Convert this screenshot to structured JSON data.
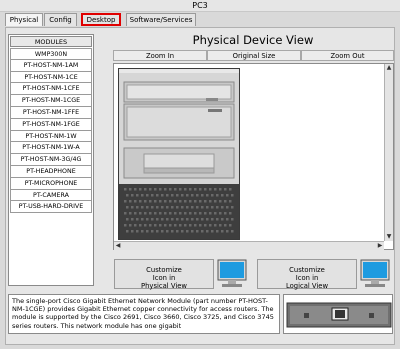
{
  "window": {
    "title": "PC3"
  },
  "tabs": [
    {
      "label": "Physical"
    },
    {
      "label": "Config"
    },
    {
      "label": "Desktop"
    },
    {
      "label": "Software/Services"
    }
  ],
  "modules": {
    "header": "MODULES",
    "items": [
      "WMP300N",
      "PT-HOST-NM-1AM",
      "PT-HOST-NM-1CE",
      "PT-HOST-NM-1CFE",
      "PT-HOST-NM-1CGE",
      "PT-HOST-NM-1FFE",
      "PT-HOST-NM-1FGE",
      "PT-HOST-NM-1W",
      "PT-HOST-NM-1W-A",
      "PT-HOST-NM-3G/4G",
      "PT-HEADPHONE",
      "PT-MICROPHONE",
      "PT-CAMERA",
      "PT-USB-HARD-DRIVE"
    ]
  },
  "physical_view": {
    "title": "Physical Device View",
    "zoom_in": "Zoom In",
    "original_size": "Original Size",
    "zoom_out": "Zoom Out"
  },
  "customize": {
    "physical": {
      "line1": "Customize",
      "line2": "Icon in",
      "line3": "Physical View"
    },
    "logical": {
      "line1": "Customize",
      "line2": "Icon in",
      "line3": "Logical View"
    }
  },
  "description": "The single-port Cisco Gigabit Ethernet Network Module (part number PT-HOST-NM-1CGE) provides Gigabit Ethernet copper connectivity for access routers. The module is supported by the Cisco 2691, Cisco 3660, Cisco 3725, and Cisco 3745 series routers. This network module has one gigabit",
  "colors": {
    "highlight_outline": "#e00000",
    "monitor_screen": "#1e9be0"
  }
}
